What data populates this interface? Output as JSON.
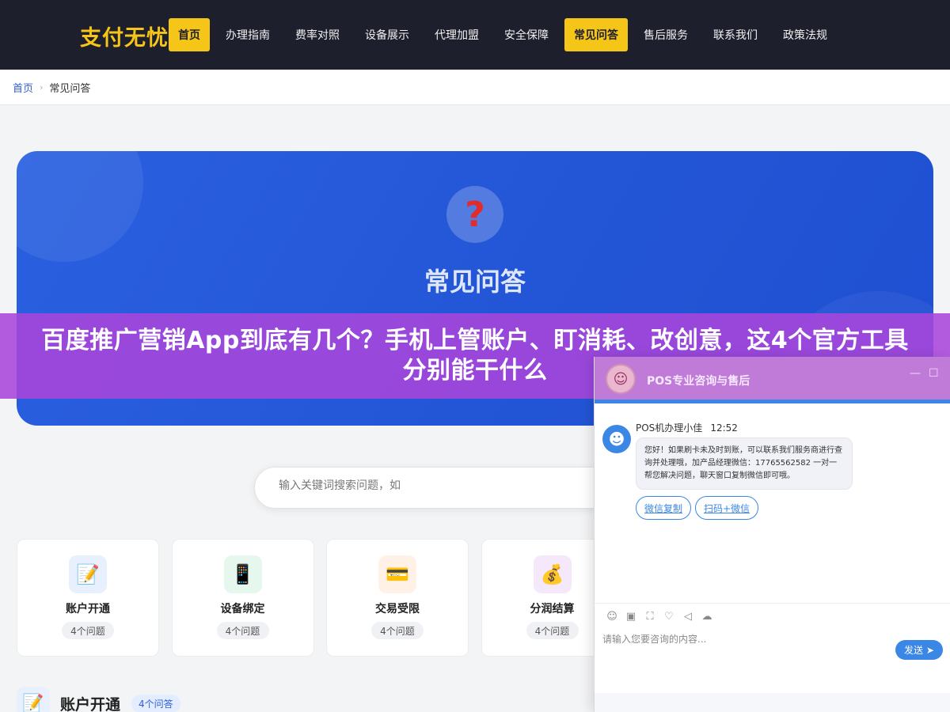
{
  "header": {
    "logo": "支付无忧",
    "nav": [
      {
        "label": "首页",
        "active": true
      },
      {
        "label": "办理指南",
        "active": false
      },
      {
        "label": "费率对照",
        "active": false
      },
      {
        "label": "设备展示",
        "active": false
      },
      {
        "label": "代理加盟",
        "active": false
      },
      {
        "label": "安全保障",
        "active": false
      },
      {
        "label": "常见问答",
        "active": true
      },
      {
        "label": "售后服务",
        "active": false
      },
      {
        "label": "联系我们",
        "active": false
      },
      {
        "label": "政策法规",
        "active": false
      }
    ],
    "accent_color": "#f5c518"
  },
  "breadcrumb": {
    "home": "首页",
    "current": "常见问答"
  },
  "hero": {
    "icon": "question-mark-icon",
    "title": "常见问答"
  },
  "banner": {
    "text": "百度推广营销App到底有几个？手机上管账户、盯消耗、改创意，这4个官方工具分别能干什么"
  },
  "search": {
    "placeholder": "输入关键词搜索问题，如"
  },
  "categories": [
    {
      "title": "账户开通",
      "count": "4个问题",
      "icon": "📝",
      "icon_name": "memo-icon",
      "icon_bg": "#e8f0fe"
    },
    {
      "title": "设备绑定",
      "count": "4个问题",
      "icon": "📱",
      "icon_name": "phone-icon",
      "icon_bg": "#e6f7ee"
    },
    {
      "title": "交易受限",
      "count": "4个问题",
      "icon": "💳",
      "icon_name": "card-icon",
      "icon_bg": "#fff1e6"
    },
    {
      "title": "分润结算",
      "count": "4个问题",
      "icon": "💰",
      "icon_name": "money-bag-icon",
      "icon_bg": "#f6e8fb"
    }
  ],
  "section": {
    "title": "账户开通",
    "badge": "4个问答",
    "icon": "📝"
  },
  "chat": {
    "title": "POS专业咨询与售后",
    "minimize": "—",
    "maximize": "☐",
    "agent_name": "POS机办理小佳",
    "time": "12:52",
    "message": "您好！如果刷卡未及时到账，可以联系我们服务商进行查询并处理哦，加产品经理微信：17765562582 一对一帮您解决问题，聊天窗口复制微信即可哦。",
    "quick_replies": [
      "微信复制",
      "扫码+微信"
    ],
    "tools": [
      "☺",
      "▣",
      "⛶",
      "♡",
      "◁",
      "☁"
    ],
    "input_placeholder": "请输入您要咨询的内容...",
    "send_label": "发送",
    "accent_color": "#3a87e6"
  }
}
